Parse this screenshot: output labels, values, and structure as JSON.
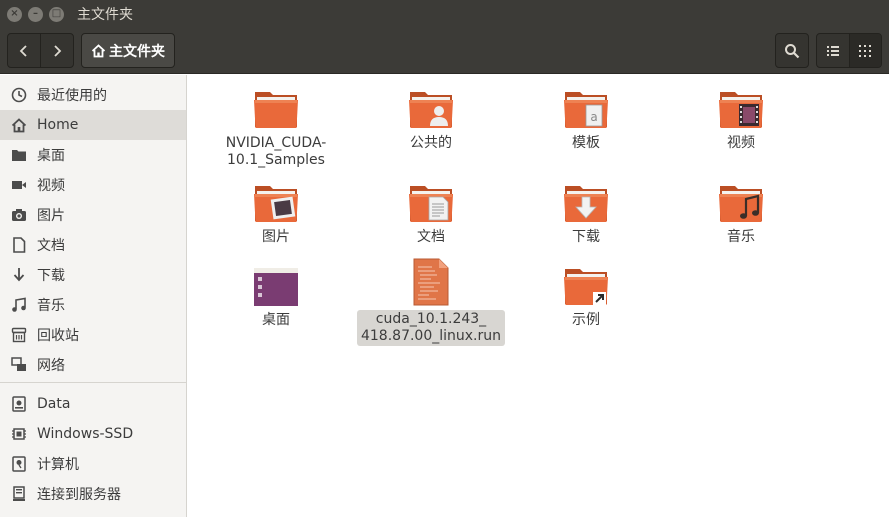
{
  "window": {
    "title": "主文件夹",
    "close_glyph": "×",
    "minimize_glyph": "–",
    "maximize_glyph": "□"
  },
  "toolbar": {
    "back_icon": "chevron-left-icon",
    "forward_icon": "chevron-right-icon",
    "path_label": "主文件夹",
    "search_icon": "search-icon",
    "view_list_icon": "list-view-icon",
    "view_grid_icon": "grid-view-icon"
  },
  "sidebar": {
    "items": [
      {
        "label": "最近使用的",
        "icon": "clock-icon"
      },
      {
        "label": "Home",
        "icon": "home-icon"
      },
      {
        "label": "桌面",
        "icon": "folder-icon"
      },
      {
        "label": "视频",
        "icon": "video-icon"
      },
      {
        "label": "图片",
        "icon": "camera-icon"
      },
      {
        "label": "文档",
        "icon": "document-icon"
      },
      {
        "label": "下载",
        "icon": "download-icon"
      },
      {
        "label": "音乐",
        "icon": "music-icon"
      },
      {
        "label": "回收站",
        "icon": "trash-icon"
      },
      {
        "label": "网络",
        "icon": "network-icon"
      },
      {
        "label": "Data",
        "icon": "drive-icon"
      },
      {
        "label": "Windows-SSD",
        "icon": "chip-icon"
      },
      {
        "label": "计算机",
        "icon": "computer-drive-icon"
      },
      {
        "label": "连接到服务器",
        "icon": "server-icon"
      }
    ]
  },
  "files": [
    {
      "label": "NVIDIA_CUDA-\n10.1_Samples",
      "icon": "folder-icon"
    },
    {
      "label": "公共的",
      "icon": "public-folder-icon"
    },
    {
      "label": "模板",
      "icon": "templates-folder-icon"
    },
    {
      "label": "视频",
      "icon": "videos-folder-icon"
    },
    {
      "label": "图片",
      "icon": "pictures-folder-icon"
    },
    {
      "label": "文档",
      "icon": "documents-folder-icon"
    },
    {
      "label": "下载",
      "icon": "downloads-folder-icon"
    },
    {
      "label": "音乐",
      "icon": "music-folder-icon"
    },
    {
      "label": "桌面",
      "icon": "desktop-folder-icon"
    },
    {
      "label": "cuda_10.1.243_\n418.87.00_linux.run",
      "icon": "script-file-icon"
    },
    {
      "label": "示例",
      "icon": "examples-folder-link-icon"
    }
  ],
  "colors": {
    "titlebar": "#3c3b37",
    "folder_orange": "#e9693a",
    "sidebar_bg": "#f5f4f2",
    "selection": "#d8d6d2"
  }
}
